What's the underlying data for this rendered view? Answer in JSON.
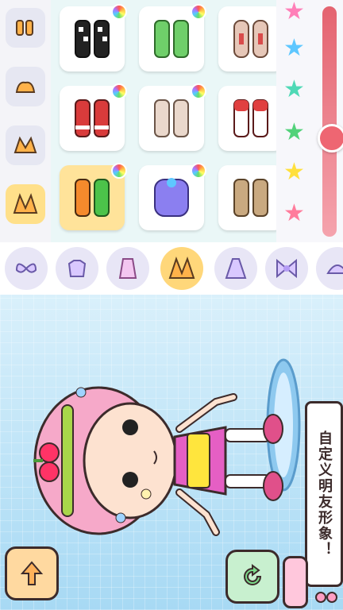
{
  "banner": {
    "text": "自定义明友形象！"
  },
  "colors": {
    "stars": [
      "#ff7fb8",
      "#5ec7ff",
      "#4fd9b6",
      "#52d27a",
      "#ffe03d",
      "#ff7c9c"
    ],
    "slider_top": "#e46470",
    "accent_selected": "#ffe08a"
  },
  "left_rail": {
    "items": [
      {
        "icon": "socks-icon",
        "selected": false
      },
      {
        "icon": "low-shoe-icon",
        "selected": false
      },
      {
        "icon": "sneaker-icon",
        "selected": false
      },
      {
        "icon": "high-shoe-icon",
        "selected": true
      }
    ]
  },
  "wardrobe": {
    "items": [
      {
        "icon": "checkered-shoe-icon",
        "color_option": true
      },
      {
        "icon": "green-shoe-icon",
        "color_option": true
      },
      {
        "icon": "boxing-shoe-icon",
        "color_option": false
      },
      {
        "icon": "red-striped-shoe-icon",
        "color_option": true
      },
      {
        "icon": "beige-sneaker-icon",
        "color_option": true
      },
      {
        "icon": "red-white-shoe-icon",
        "color_option": false
      },
      {
        "icon": "orange-green-shoe-icon",
        "color_option": true,
        "selected": true
      },
      {
        "icon": "purple-boot-icon",
        "color_option": true
      },
      {
        "icon": "tan-boot-icon",
        "color_option": false
      }
    ]
  },
  "color_slider": {
    "level": 0.57
  },
  "categories": [
    {
      "icon": "wings-icon"
    },
    {
      "icon": "top-icon"
    },
    {
      "icon": "dress-icon"
    },
    {
      "icon": "shoes-icon",
      "selected": true
    },
    {
      "icon": "gown-icon"
    },
    {
      "icon": "bow-icon"
    },
    {
      "icon": "hat-icon"
    }
  ],
  "buttons": {
    "back": {
      "icon": "back-arrow-icon",
      "color": "#ffb15a"
    },
    "refresh": {
      "icon": "refresh-icon",
      "color": "#7bdc8a"
    }
  }
}
